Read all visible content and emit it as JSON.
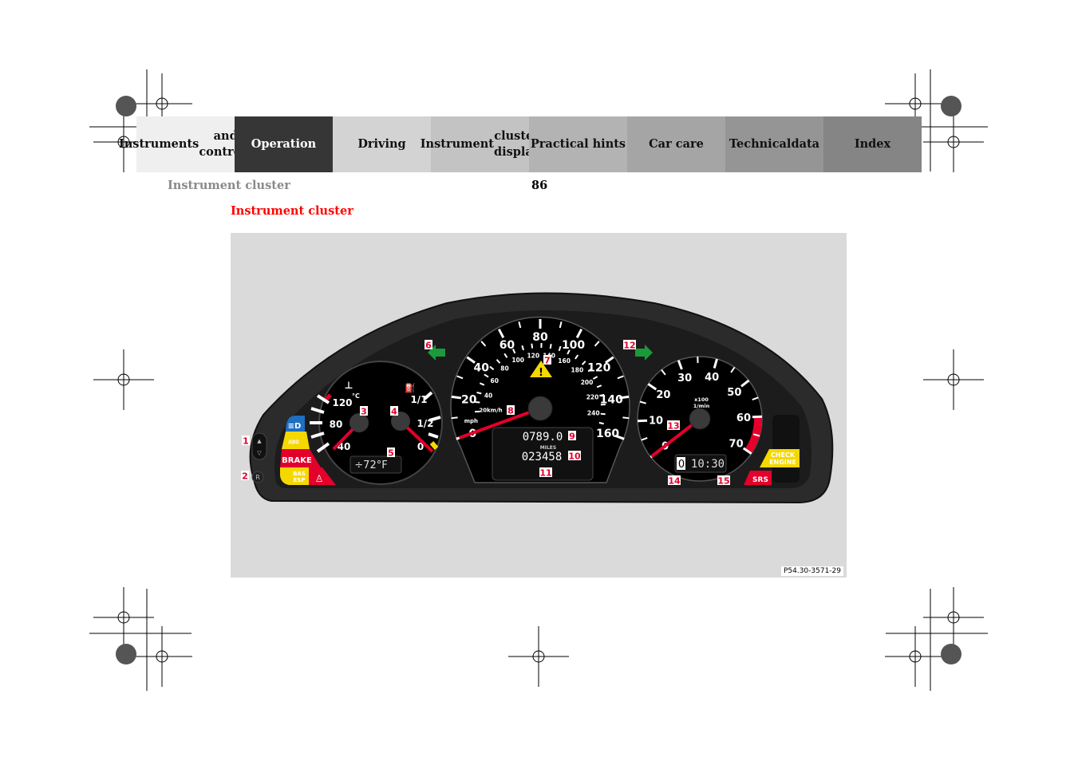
{
  "nav": {
    "tabs": [
      {
        "label_lines": [
          "Instruments",
          "and controls"
        ],
        "bg": "#efefef",
        "fg": "#111111"
      },
      {
        "label_lines": [
          "Operation"
        ],
        "bg": "#363636",
        "fg": "#ffffff",
        "active": true
      },
      {
        "label_lines": [
          "Driving"
        ],
        "bg": "#d3d3d3",
        "fg": "#111111"
      },
      {
        "label_lines": [
          "Instrument",
          "cluster display"
        ],
        "bg": "#c3c3c3",
        "fg": "#111111"
      },
      {
        "label_lines": [
          "Practical hints"
        ],
        "bg": "#b3b3b3",
        "fg": "#111111"
      },
      {
        "label_lines": [
          "Car care"
        ],
        "bg": "#a5a5a5",
        "fg": "#111111"
      },
      {
        "label_lines": [
          "Technical",
          "data"
        ],
        "bg": "#959595",
        "fg": "#111111"
      },
      {
        "label_lines": [
          "Index"
        ],
        "bg": "#858585",
        "fg": "#111111"
      }
    ]
  },
  "header": {
    "section": "Instrument cluster",
    "page_number": "86"
  },
  "heading": {
    "title": "Instrument cluster",
    "color": "#ff0000"
  },
  "figure": {
    "ref": "P54.30-3571-29",
    "speedometer": {
      "mph_labels": [
        "0",
        "20",
        "40",
        "60",
        "80",
        "100",
        "120",
        "140",
        "160"
      ],
      "kmh_labels": [
        "40",
        "60",
        "80",
        "100",
        "120",
        "140",
        "160",
        "180",
        "200",
        "220",
        "240"
      ],
      "kmh_unit": "20km/h",
      "mph_unit": "mph",
      "speed_mph": 0
    },
    "tachometer": {
      "labels": [
        "0",
        "10",
        "20",
        "30",
        "40",
        "50",
        "60",
        "70"
      ],
      "unit_line1": "x100",
      "unit_line2": "1/min",
      "rpm_x100": 0,
      "redline_from": 60
    },
    "coolant_gauge": {
      "labels": [
        "40",
        "80",
        "120"
      ],
      "unit": "°C"
    },
    "fuel_gauge": {
      "labels": [
        "0",
        "1/2",
        "1/1"
      ]
    },
    "outside_temp": "÷72°F",
    "display": {
      "trip": "0789.0",
      "unit": "MILES",
      "odometer": "023458",
      "gear": "0",
      "clock": "10:30"
    },
    "warning_lamps": {
      "brake": "BRAKE",
      "abs": "ABS",
      "bas_esp": [
        "BAS",
        "ESP"
      ],
      "check_engine": [
        "CHECK",
        "ENGINE"
      ],
      "srs": "SRS"
    },
    "buttons": {
      "reset": "R"
    },
    "callouts": [
      "1",
      "2",
      "3",
      "4",
      "5",
      "6",
      "7",
      "8",
      "9",
      "10",
      "11",
      "12",
      "13",
      "14",
      "15"
    ],
    "colors": {
      "needle": "#e3002b",
      "callout": "#e3002b",
      "yellow": "#f5d800",
      "blue": "#1e6fc0",
      "green": "#1a9a3a"
    }
  }
}
